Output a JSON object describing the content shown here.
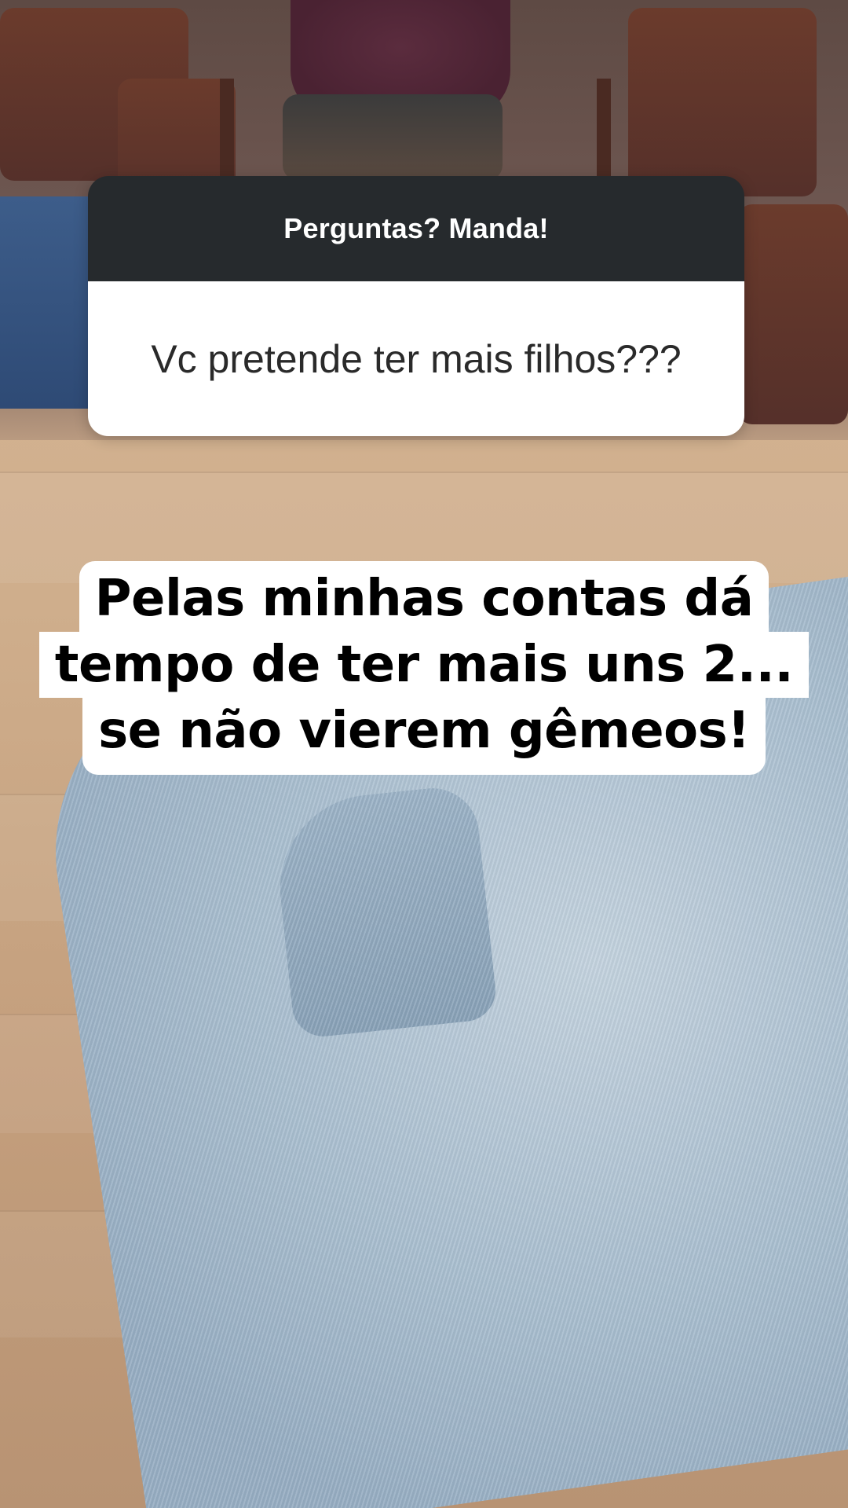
{
  "question_sticker": {
    "header": "Perguntas? Manda!",
    "question": "Vc pretende ter mais filhos???",
    "header_color": "#262a2d",
    "body_color": "#ffffff"
  },
  "answer_caption": {
    "lines": [
      "Pelas minhas contas dá",
      "tempo de ter mais uns 2...",
      "se não vierem gêmeos!"
    ],
    "text_color": "#000000",
    "background_color": "#ffffff"
  }
}
